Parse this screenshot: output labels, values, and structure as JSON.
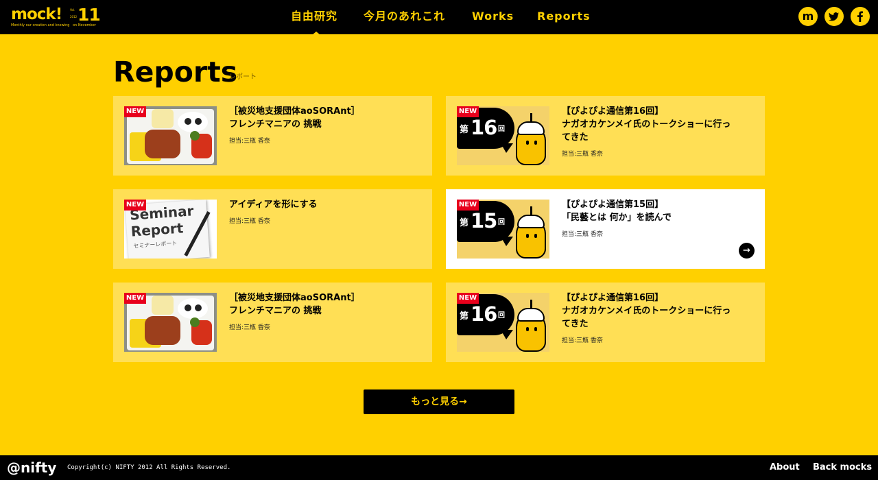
{
  "header": {
    "logo": {
      "main": "mock!",
      "number": "11",
      "year": "2012",
      "vol": "Vol.",
      "tagline": "Monthly our creation and knowing",
      "month": "on November"
    },
    "nav": [
      "自由研究",
      "今月のあれこれ",
      "Works",
      "Reports"
    ],
    "social": [
      "m",
      "t",
      "f"
    ]
  },
  "main": {
    "title": "Reports",
    "subtitle": "レポート",
    "badge": "NEW",
    "cards": [
      {
        "title_line1": "［被災地支援団体aoSORAnt］",
        "title_line2": "フレンチマニアの 挑戦",
        "title_line3": "",
        "author": "担当:三瓶 香奈",
        "thumb": "bento"
      },
      {
        "title_line1": "【ぴよぴよ通信第16回】",
        "title_line2": "ナガオカケンメイ氏のトークショーに行っ",
        "title_line3": "てきた",
        "author": "担当:三瓶 香奈",
        "thumb": "piyo",
        "thumb_dai": "第",
        "thumb_num": "16",
        "thumb_kai": "回"
      },
      {
        "title_line1": "アイディアを形にする",
        "title_line2": "",
        "title_line3": "",
        "author": "担当:三瓶 香奈",
        "thumb": "seminar",
        "thumb_text1": "Seminar",
        "thumb_text2": "Report",
        "thumb_text3": "セミナーレポート"
      },
      {
        "title_line1": "【ぴよぴよ通信第15回】",
        "title_line2": "「民藝とは 何か」を読んで",
        "title_line3": "",
        "author": "担当:三瓶 香奈",
        "thumb": "piyo",
        "thumb_dai": "第",
        "thumb_num": "15",
        "thumb_kai": "回",
        "active": true
      },
      {
        "title_line1": "［被災地支援団体aoSORAnt］",
        "title_line2": "フレンチマニアの 挑戦",
        "title_line3": "",
        "author": "担当:三瓶 香奈",
        "thumb": "bento"
      },
      {
        "title_line1": "【ぴよぴよ通信第16回】",
        "title_line2": "ナガオカケンメイ氏のトークショーに行っ",
        "title_line3": "てきた",
        "author": "担当:三瓶 香奈",
        "thumb": "piyo",
        "thumb_dai": "第",
        "thumb_num": "16",
        "thumb_kai": "回"
      }
    ],
    "go_icon": "→",
    "more_label": "もっと見る→"
  },
  "footer": {
    "logo": "@nifty",
    "copyright": "Copyright(c) NIFTY 2012 All Rights Reserved.",
    "links": [
      "About",
      "Back mocks"
    ]
  },
  "colors": {
    "background": "#ffd000",
    "card": "#ffdf55",
    "card_active": "#ffffff",
    "header": "#000000",
    "accent": "#ffd000",
    "badge": "#e8001c"
  },
  "icons": {
    "social": [
      "mock-icon",
      "twitter-icon",
      "facebook-icon"
    ],
    "go": "arrow-right-circle-icon",
    "nav_indicator": "triangle-up-icon"
  }
}
